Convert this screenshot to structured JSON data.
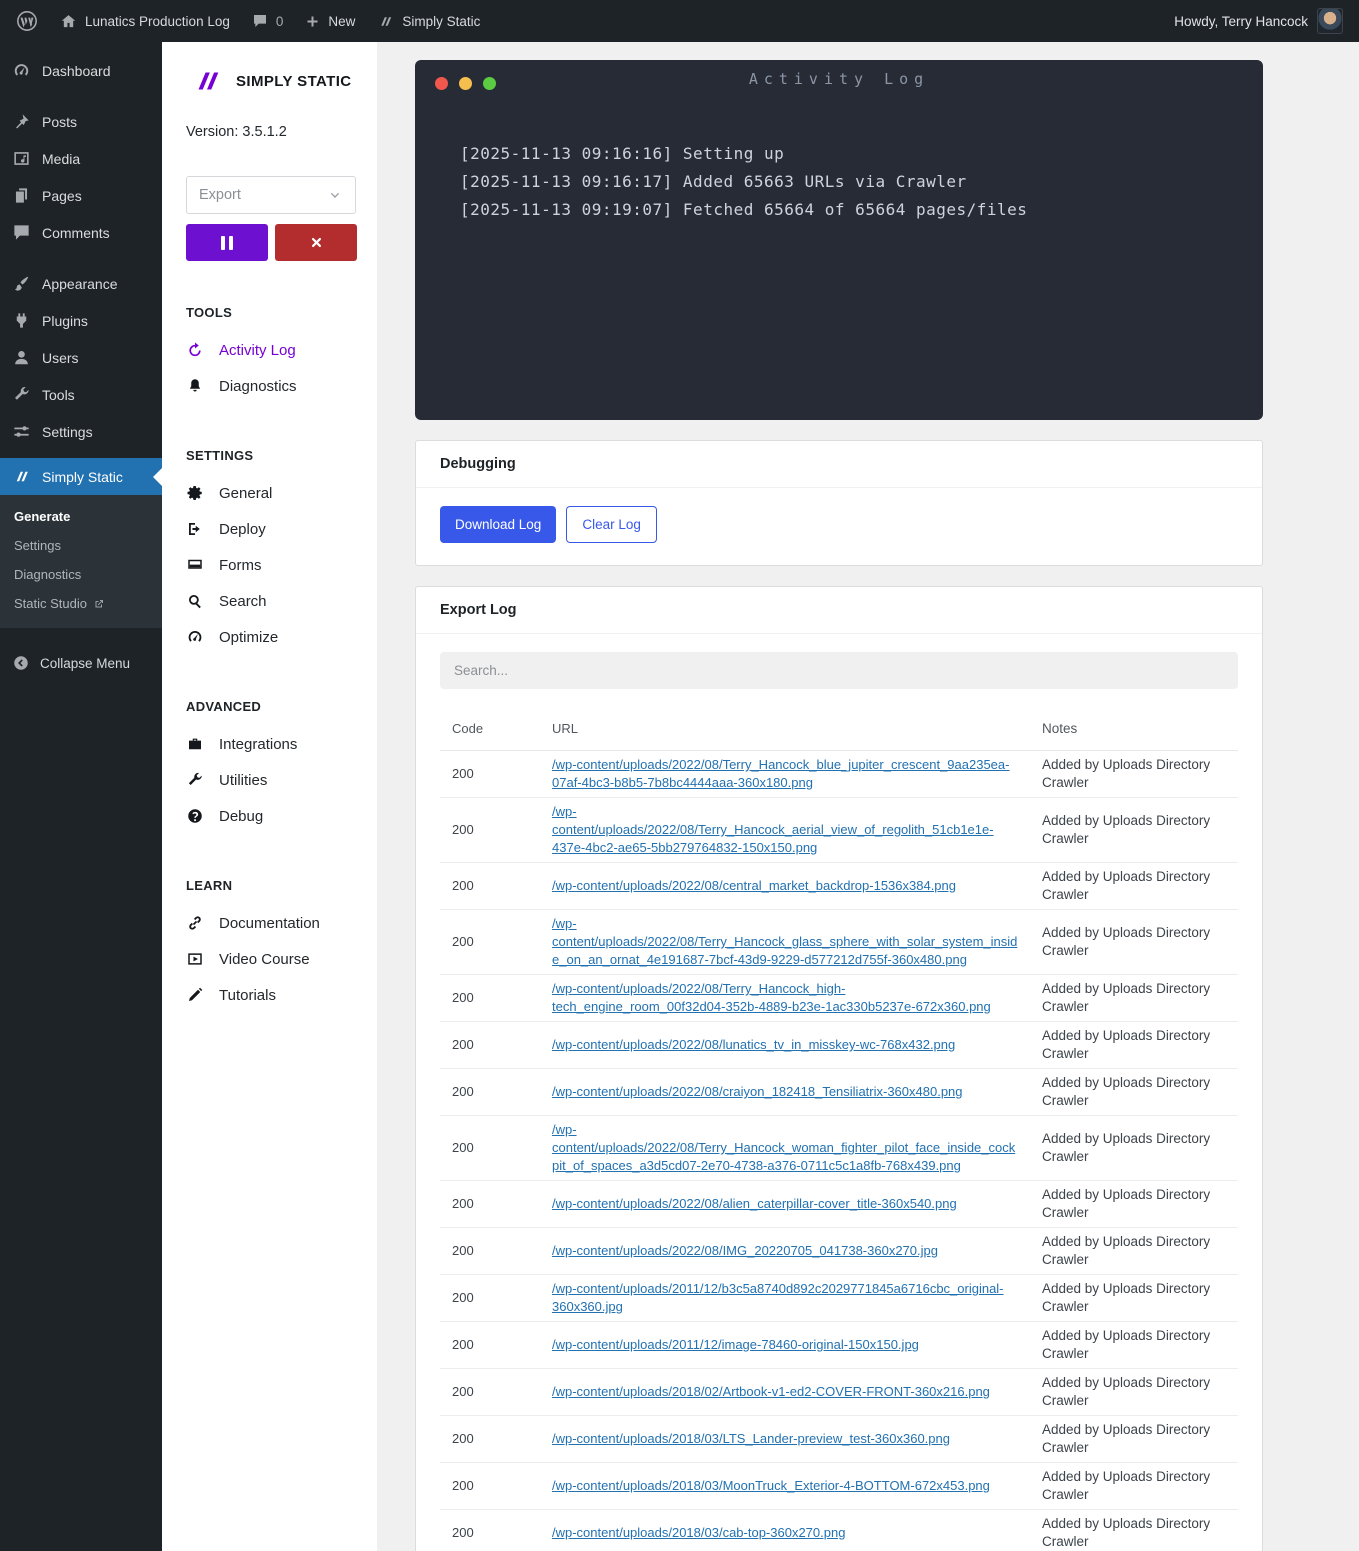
{
  "colors": {
    "brand_purple": "#7700d4",
    "action_blue": "#3858e9",
    "link_blue": "#2271b1",
    "active_menu_blue": "#2271b1",
    "danger_red": "#b32d2e",
    "terminal_bg": "#262b36",
    "dot_red": "#f1574d",
    "dot_yellow": "#f5bf4f",
    "dot_green": "#5bcb43"
  },
  "admin_bar": {
    "site_name": "Lunatics Production Log",
    "comments_count": "0",
    "new_label": "New",
    "plugin_label": "Simply Static",
    "howdy": "Howdy, Terry Hancock"
  },
  "wp_sidebar": {
    "items": [
      {
        "label": "Dashboard"
      },
      {
        "label": "Posts"
      },
      {
        "label": "Media"
      },
      {
        "label": "Pages"
      },
      {
        "label": "Comments"
      },
      {
        "label": "Appearance"
      },
      {
        "label": "Plugins"
      },
      {
        "label": "Users"
      },
      {
        "label": "Tools"
      },
      {
        "label": "Settings"
      },
      {
        "label": "Simply Static"
      }
    ],
    "submenu": [
      {
        "label": "Generate"
      },
      {
        "label": "Settings"
      },
      {
        "label": "Diagnostics"
      },
      {
        "label": "Static Studio"
      }
    ],
    "collapse_label": "Collapse Menu"
  },
  "plugin_sidebar": {
    "brand": "SIMPLY STATIC",
    "version": "Version: 3.5.1.2",
    "export_select": "Export",
    "sections": {
      "tools": {
        "title": "TOOLS",
        "items": [
          {
            "label": "Activity Log"
          },
          {
            "label": "Diagnostics"
          }
        ]
      },
      "settings": {
        "title": "SETTINGS",
        "items": [
          {
            "label": "General"
          },
          {
            "label": "Deploy"
          },
          {
            "label": "Forms"
          },
          {
            "label": "Search"
          },
          {
            "label": "Optimize"
          }
        ]
      },
      "advanced": {
        "title": "ADVANCED",
        "items": [
          {
            "label": "Integrations"
          },
          {
            "label": "Utilities"
          },
          {
            "label": "Debug"
          }
        ]
      },
      "learn": {
        "title": "LEARN",
        "items": [
          {
            "label": "Documentation"
          },
          {
            "label": "Video Course"
          },
          {
            "label": "Tutorials"
          }
        ]
      }
    }
  },
  "terminal": {
    "title": "Activity Log",
    "lines": [
      "[2025-11-13 09:16:16] Setting up",
      "[2025-11-13 09:16:17] Added 65663 URLs via Crawler",
      "[2025-11-13 09:19:07] Fetched 65664 of 65664 pages/files"
    ]
  },
  "debugging": {
    "title": "Debugging",
    "download_label": "Download Log",
    "clear_label": "Clear Log"
  },
  "export_log": {
    "title": "Export Log",
    "search_placeholder": "Search...",
    "columns": [
      "Code",
      "URL",
      "Notes"
    ],
    "rows": [
      {
        "code": "200",
        "url": "/wp-content/uploads/2022/08/Terry_Hancock_blue_jupiter_crescent_9aa235ea-07af-4bc3-b8b5-7b8bc4444aaa-360x180.png",
        "note": "Added by Uploads Directory Crawler"
      },
      {
        "code": "200",
        "url": "/wp-content/uploads/2022/08/Terry_Hancock_aerial_view_of_regolith_51cb1e1e-437e-4bc2-ae65-5bb279764832-150x150.png",
        "note": "Added by Uploads Directory Crawler"
      },
      {
        "code": "200",
        "url": "/wp-content/uploads/2022/08/central_market_backdrop-1536x384.png",
        "note": "Added by Uploads Directory Crawler"
      },
      {
        "code": "200",
        "url": "/wp-content/uploads/2022/08/Terry_Hancock_glass_sphere_with_solar_system_inside_on_an_ornat_4e191687-7bcf-43d9-9229-d577212d755f-360x480.png",
        "note": "Added by Uploads Directory Crawler"
      },
      {
        "code": "200",
        "url": "/wp-content/uploads/2022/08/Terry_Hancock_high-tech_engine_room_00f32d04-352b-4889-b23e-1ac330b5237e-672x360.png",
        "note": "Added by Uploads Directory Crawler"
      },
      {
        "code": "200",
        "url": "/wp-content/uploads/2022/08/lunatics_tv_in_misskey-wc-768x432.png",
        "note": "Added by Uploads Directory Crawler"
      },
      {
        "code": "200",
        "url": "/wp-content/uploads/2022/08/craiyon_182418_Tensiliatrix-360x480.png",
        "note": "Added by Uploads Directory Crawler"
      },
      {
        "code": "200",
        "url": "/wp-content/uploads/2022/08/Terry_Hancock_woman_fighter_pilot_face_inside_cockpit_of_spaces_a3d5cd07-2e70-4738-a376-0711c5c1a8fb-768x439.png",
        "note": "Added by Uploads Directory Crawler"
      },
      {
        "code": "200",
        "url": "/wp-content/uploads/2022/08/alien_caterpillar-cover_title-360x540.png",
        "note": "Added by Uploads Directory Crawler"
      },
      {
        "code": "200",
        "url": "/wp-content/uploads/2022/08/IMG_20220705_041738-360x270.jpg",
        "note": "Added by Uploads Directory Crawler"
      },
      {
        "code": "200",
        "url": "/wp-content/uploads/2011/12/b3c5a8740d892c2029771845a6716cbc_original-360x360.jpg",
        "note": "Added by Uploads Directory Crawler"
      },
      {
        "code": "200",
        "url": "/wp-content/uploads/2011/12/image-78460-original-150x150.jpg",
        "note": "Added by Uploads Directory Crawler"
      },
      {
        "code": "200",
        "url": "/wp-content/uploads/2018/02/Artbook-v1-ed2-COVER-FRONT-360x216.png",
        "note": "Added by Uploads Directory Crawler"
      },
      {
        "code": "200",
        "url": "/wp-content/uploads/2018/03/LTS_Lander-preview_test-360x360.png",
        "note": "Added by Uploads Directory Crawler"
      },
      {
        "code": "200",
        "url": "/wp-content/uploads/2018/03/MoonTruck_Exterior-4-BOTTOM-672x453.png",
        "note": "Added by Uploads Directory Crawler"
      },
      {
        "code": "200",
        "url": "/wp-content/uploads/2018/03/cab-top-360x270.png",
        "note": "Added by Uploads Directory Crawler"
      }
    ]
  }
}
